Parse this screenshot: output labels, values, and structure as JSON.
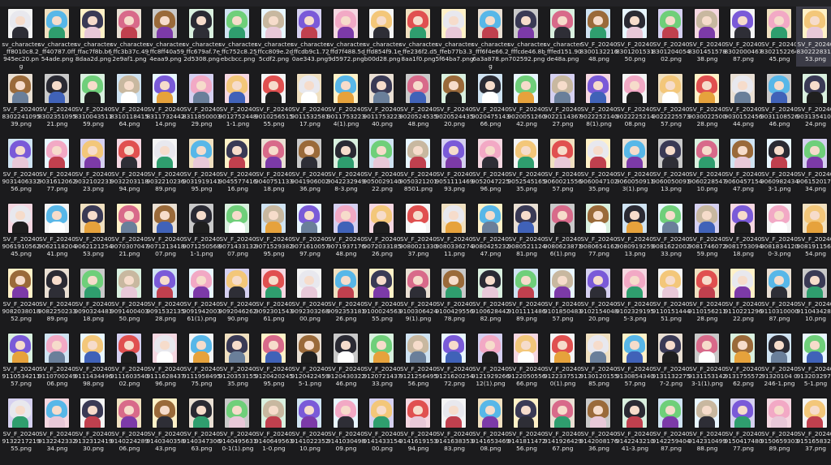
{
  "toolbar": {
    "items": [
      "",
      "",
      "",
      "",
      "",
      "",
      ""
    ]
  },
  "selected_file": "SV_F_20240830222831153.png",
  "files": [
    "sv_character_ff8010c8.2945ec20.png",
    "sv_character_ff40787.0ff54ade.png",
    "sv_character_ffac7f8b.b68daa2d.png",
    "sv_character_ffc3b37c.492e9af1.png",
    "sv_character_ffc8ff40a594eaa9.png",
    "sv_character_ffc679af.7e2d5308.png",
    "sv_character_ffc752c8.25ebcbcc.png",
    "sv_character_ffcc809e.2d5cdf2.png",
    "sv_character_ffcdb9c1.720ae343.png",
    "sv_character_ffd7f488.5d9d5972.png",
    "sv_character_ffd854f9.1eb00d28.png",
    "sv_character_ffe236f2.d58aa1f0.png",
    "sv_character_ffeb77b3.35f64ba7.png",
    "sv_character_fff6f4e66.26a3a878.png",
    "sv_character_fffcde46.8b702592.png",
    "sv_character_fffed151.90de48a.png",
    "SV_F_20240830013221648.png",
    "SV_F_20240830120153150.png",
    "SV_F_20240830120405402.png",
    "SV_F_20240830145157838.png",
    "SV_F_20240830200046787.png",
    "SV_F_20240830215226445.png",
    "SV_F_20240830222831153.png",
    "SV_F_20240830224109539.png",
    "SV_F_20240830235109521.png",
    "SV_F_20240831004351159.png",
    "SV_F_20240831011841564.png",
    "SV_F_20240831173244214.png",
    "SV_F_20240831185000329.png",
    "SV_F_2024090127524481-1.png",
    "SV_F_20240901025651555.png",
    "SV_F_20240901153258117.png",
    "SV_F_2024090117532234(1).png",
    "SV_F_20240901175322340.png",
    "SV_F_20240902052453548.png",
    "SV_F_20240902052443520.png",
    "SV_F_20240902047514366.png",
    "SV_F_20240902005126042.png",
    "SV_F_20240902211436727.png",
    "SV_F_2024090222521408(1).png",
    "SV_F_20240902222521408.png",
    "SV_F_20240902222557357.png",
    "SV_F_20240903002250028.png",
    "SV_F_20240903015245644.png",
    "SV_F_20240903110852646.png",
    "SV_F_20240903135410424.png",
    "SV_F_20240903140633256.png",
    "SV_F_20240903161206277.png",
    "SV_F_20240903210223123.png",
    "SV_F_20240903220311894.png",
    "SV_F_20240903221023689.png",
    "SV_F_20240903191914195.png",
    "SV_F_20240904557741616.png",
    "SV_F_20240904075113318.png",
    "SV_F_20240904190600236.png",
    "SV_F_2024090422329498-3.png",
    "SV_F_20240905002914022.png",
    "SV_F_2024090503212018501.png",
    "SV_F_20240905111146993.png",
    "SV_F_20240905204722596.png",
    "SV_F_20240905254516535.png",
    "SV_F_20240906002155657.png",
    "SV_F_20240906004710235.png",
    "SV_F_2024090600509113(1).png",
    "SV_F_20240906005009113.png",
    "SV_F_20240906022854710.png",
    "SV_F_20240906045715447.png",
    "SV_F_2024090609824343-1.png",
    "SV_F_20240906152017434.png",
    "SV_F_20240906191056245.png",
    "SV_F_20240906211820441.png",
    "SV_F_20240906212125453.png",
    "SV_F_20240907030704721.png",
    "SV_F_20240907121341807.png",
    "SV_F_2024090712505681-1.png",
    "SV_F_20240907143313207.png",
    "SV_F_20240907152938295.png",
    "SV_F_20240907161005797.png",
    "SV_F_20240907193717648.png",
    "SV_F_20240907203318526.png",
    "SV_F_20240908002133037.png",
    "SV_F_20240908033627411.png",
    "SV_F_20240908042523247.png",
    "SV_F_20240908052112481.png",
    "SV_F_2024090806238716(1).png",
    "SV_F_20240908065416277.png",
    "SV_F_20240908091925913.png",
    "SV_F_20240908162200233.png",
    "SV_F_20240908174607259.png",
    "SV_F_20240908175309418.png",
    "SV_F_2024090818341200-3.png",
    "SV_F_20240908191156954.png",
    "SV_F_20240908203801852.png",
    "SV_F_20240908225023389.png",
    "SV_F_20240909032448118.png",
    "SV_F_20240909140040350.png",
    "SV_F_20240909153213528.png",
    "SV_F_20240909194200361(1).png",
    "SV_F_20240909204626290.png",
    "SV_F_20240909230154361.png",
    "SV_F_20240909230326800.png",
    "SV_F_20240909235318126.png",
    "SV_F_20240910002456355.png",
    "SV_F_2024091003064249(1).png",
    "SV_F_20240910042955678.png",
    "SV_F_20240910062844282.png",
    "SV_F_20240910111148689.png",
    "SV_F_20240910185048357.png",
    "SV_F_20240910215404820.png",
    "SV_F_2024091023291955-3.png",
    "SV_F_20240911015144451.png",
    "SV_F_20240911015621128.png",
    "SV_F_20240911022129622.png",
    "SV_F_20240911031000087.png",
    "SV_F_20240911043428810.png",
    "SV_F_20240911053421157.png",
    "SV_F_20240911070024906.png",
    "SV_F_20240911143449698.png",
    "SV_F_20240911160354002.png",
    "SV_F_20240911162843796.png",
    "SV_F_20240911195849575.png",
    "SV_F_20240912035315535.png",
    "SV_F_20240912042024595.png",
    "SV_F_2024091204224595-1.png",
    "SV_F_20240912043032246.png",
    "SV_F_20240912072143733.png",
    "SV_F_20240912125649556.png",
    "SV_F_20240912162025472.png",
    "SV_F_20240912192926612(1).png",
    "SV_F_20240912205055666.png",
    "SV_F_2024091223375120(1).png",
    "SV_F_20240913012015585.png",
    "SV_F_20240913085434057.png",
    "SV_F_2024091311322757-2.png",
    "SV_F_2024091311531423-1(1).png",
    "SV_F_20240913175557262.png",
    "SV_F_2024091320104 0246-1.png",
    "SV_F_2024091320329745-1.png",
    "SV_F_20240913221721955.png",
    "SV_F_20240913224233234.png",
    "SV_F_20240913231241930.png",
    "SV_F_20240914022428906.png",
    "SV_F_20240914034035843.png",
    "SV_F_20240914034730663.png",
    "SV_F_2024091404956310-1(1).png",
    "SV_F_2024091406495631-0.png",
    "SV_F_20240914102235210.png",
    "SV_F_20240914103049809.png",
    "SV_F_20240914143315400.png",
    "SV_F_20240914161915394.png",
    "SV_F_20240914163835383.png",
    "SV_F_20240914165346908.png",
    "SV_F_20240914181147256.png",
    "SV_F_20240914192642967.png",
    "SV_F_20240914200817636.png",
    "SV_F_20240914224321041-3.png",
    "SV_F_20240914225940487.png",
    "SV_F_20240914231049988.png",
    "SV_F_20240915041748077.png",
    "SV_F_20240915065930389.png",
    "SV_F_20240915165832237.png"
  ]
}
